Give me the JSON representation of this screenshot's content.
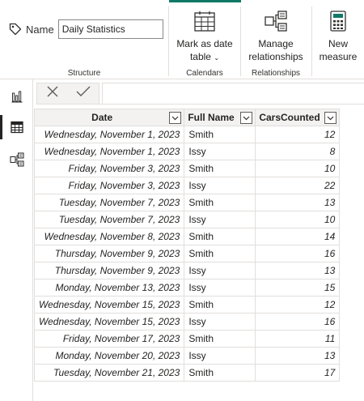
{
  "ribbon": {
    "name_label": "Name",
    "name_value": "Daily Statistics",
    "groups": {
      "structure": "Structure",
      "calendars": "Calendars",
      "relationships": "Relationships"
    },
    "buttons": {
      "mark_as_date_table_line1": "Mark as date",
      "mark_as_date_table_line2": "table",
      "manage_relationships_line1": "Manage",
      "manage_relationships_line2": "relationships",
      "new_measure_line1": "New",
      "new_measure_line2": "measure"
    },
    "accent_color": "#117865"
  },
  "rail": {
    "items": [
      {
        "icon": "report-view-icon",
        "active": false
      },
      {
        "icon": "table-view-icon",
        "active": true
      },
      {
        "icon": "model-view-icon",
        "active": false
      }
    ]
  },
  "formula_bar": {
    "cancel_icon": "close-icon",
    "commit_icon": "check-icon",
    "value": ""
  },
  "table": {
    "columns": [
      "Date",
      "Full Name",
      "CarsCounted"
    ],
    "rows": [
      {
        "date": "Wednesday, November 1, 2023",
        "name": "Smith",
        "cars": "12"
      },
      {
        "date": "Wednesday, November 1, 2023",
        "name": "Issy",
        "cars": "8"
      },
      {
        "date": "Friday, November 3, 2023",
        "name": "Smith",
        "cars": "10"
      },
      {
        "date": "Friday, November 3, 2023",
        "name": "Issy",
        "cars": "22"
      },
      {
        "date": "Tuesday, November 7, 2023",
        "name": "Smith",
        "cars": "13"
      },
      {
        "date": "Tuesday, November 7, 2023",
        "name": "Issy",
        "cars": "10"
      },
      {
        "date": "Wednesday, November 8, 2023",
        "name": "Smith",
        "cars": "14"
      },
      {
        "date": "Thursday, November 9, 2023",
        "name": "Smith",
        "cars": "16"
      },
      {
        "date": "Thursday, November 9, 2023",
        "name": "Issy",
        "cars": "13"
      },
      {
        "date": "Monday, November 13, 2023",
        "name": "Issy",
        "cars": "15"
      },
      {
        "date": "Wednesday, November 15, 2023",
        "name": "Smith",
        "cars": "12"
      },
      {
        "date": "Wednesday, November 15, 2023",
        "name": "Issy",
        "cars": "16"
      },
      {
        "date": "Friday, November 17, 2023",
        "name": "Smith",
        "cars": "11"
      },
      {
        "date": "Monday, November 20, 2023",
        "name": "Issy",
        "cars": "13"
      },
      {
        "date": "Tuesday, November 21, 2023",
        "name": "Smith",
        "cars": "17"
      }
    ]
  }
}
